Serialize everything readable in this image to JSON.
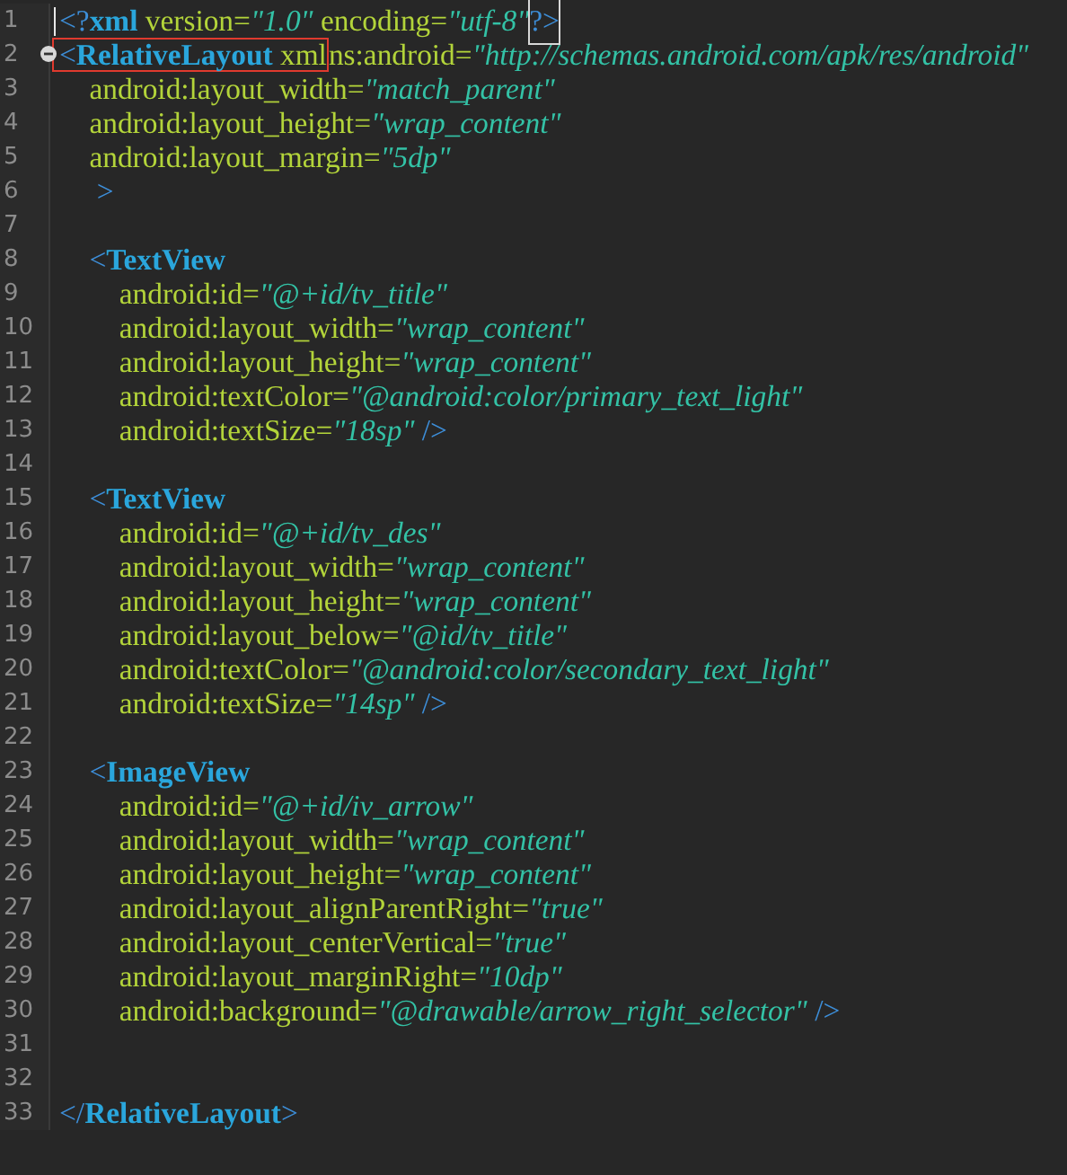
{
  "editor": {
    "lines": [
      {
        "number": "1",
        "caret": true,
        "tokens": [
          {
            "kind": "punct",
            "text": "<?"
          },
          {
            "kind": "tag",
            "text": "xml"
          },
          {
            "kind": "attr",
            "text": " version="
          },
          {
            "kind": "value",
            "text": "\"1.0\""
          },
          {
            "kind": "attr",
            "text": " encoding="
          },
          {
            "kind": "value",
            "text": "\"utf-8\""
          },
          {
            "kind": "punct",
            "text": "?>",
            "matched": true
          }
        ]
      },
      {
        "number": "2",
        "fold": {
          "expanded": true
        },
        "tokens": [
          {
            "kind": "punct",
            "text": "<",
            "boxed": true
          },
          {
            "kind": "tag",
            "text": "RelativeLayout",
            "boxed": true
          },
          {
            "kind": "attr",
            "text": " xml",
            "boxed": true
          },
          {
            "kind": "attr",
            "text": "ns:android="
          },
          {
            "kind": "value",
            "text": "\"http://schemas.android.com/apk/res/android\""
          }
        ]
      },
      {
        "number": "3",
        "tokens": [
          {
            "kind": "attr",
            "text": "    android:layout_width="
          },
          {
            "kind": "value",
            "text": "\"match_parent\""
          }
        ]
      },
      {
        "number": "4",
        "tokens": [
          {
            "kind": "attr",
            "text": "    android:layout_height="
          },
          {
            "kind": "value",
            "text": "\"wrap_content\""
          }
        ]
      },
      {
        "number": "5",
        "tokens": [
          {
            "kind": "attr",
            "text": "    android:layout_margin="
          },
          {
            "kind": "value",
            "text": "\"5dp\""
          }
        ]
      },
      {
        "number": "6",
        "tokens": [
          {
            "kind": "punct",
            "text": "     >"
          }
        ]
      },
      {
        "number": "7"
      },
      {
        "number": "8",
        "tokens": [
          {
            "kind": "punct",
            "text": "    <"
          },
          {
            "kind": "tag",
            "text": "TextView"
          }
        ]
      },
      {
        "number": "9",
        "tokens": [
          {
            "kind": "attr",
            "text": "        android:id="
          },
          {
            "kind": "value",
            "text": "\"@+id/tv_title\""
          }
        ]
      },
      {
        "number": "10",
        "tokens": [
          {
            "kind": "attr",
            "text": "        android:layout_width="
          },
          {
            "kind": "value",
            "text": "\"wrap_content\""
          }
        ]
      },
      {
        "number": "11",
        "tokens": [
          {
            "kind": "attr",
            "text": "        android:layout_height="
          },
          {
            "kind": "value",
            "text": "\"wrap_content\""
          }
        ]
      },
      {
        "number": "12",
        "tokens": [
          {
            "kind": "attr",
            "text": "        android:textColor="
          },
          {
            "kind": "value",
            "text": "\"@android:color/primary_text_light\""
          }
        ]
      },
      {
        "number": "13",
        "tokens": [
          {
            "kind": "attr",
            "text": "        android:textSize="
          },
          {
            "kind": "value",
            "text": "\"18sp\""
          },
          {
            "kind": "punct",
            "text": " />"
          }
        ]
      },
      {
        "number": "14"
      },
      {
        "number": "15",
        "tokens": [
          {
            "kind": "punct",
            "text": "    <"
          },
          {
            "kind": "tag",
            "text": "TextView"
          }
        ]
      },
      {
        "number": "16",
        "tokens": [
          {
            "kind": "attr",
            "text": "        android:id="
          },
          {
            "kind": "value",
            "text": "\"@+id/tv_des\""
          }
        ]
      },
      {
        "number": "17",
        "tokens": [
          {
            "kind": "attr",
            "text": "        android:layout_width="
          },
          {
            "kind": "value",
            "text": "\"wrap_content\""
          }
        ]
      },
      {
        "number": "18",
        "tokens": [
          {
            "kind": "attr",
            "text": "        android:layout_height="
          },
          {
            "kind": "value",
            "text": "\"wrap_content\""
          }
        ]
      },
      {
        "number": "19",
        "tokens": [
          {
            "kind": "attr",
            "text": "        android:layout_below="
          },
          {
            "kind": "value",
            "text": "\"@id/tv_title\""
          }
        ]
      },
      {
        "number": "20",
        "tokens": [
          {
            "kind": "attr",
            "text": "        android:textColor="
          },
          {
            "kind": "value",
            "text": "\"@android:color/secondary_text_light\""
          }
        ]
      },
      {
        "number": "21",
        "tokens": [
          {
            "kind": "attr",
            "text": "        android:textSize="
          },
          {
            "kind": "value",
            "text": "\"14sp\""
          },
          {
            "kind": "punct",
            "text": " />"
          }
        ]
      },
      {
        "number": "22"
      },
      {
        "number": "23",
        "tokens": [
          {
            "kind": "punct",
            "text": "    <"
          },
          {
            "kind": "tag",
            "text": "ImageView"
          }
        ]
      },
      {
        "number": "24",
        "tokens": [
          {
            "kind": "attr",
            "text": "        android:id="
          },
          {
            "kind": "value",
            "text": "\"@+id/iv_arrow\""
          }
        ]
      },
      {
        "number": "25",
        "tokens": [
          {
            "kind": "attr",
            "text": "        android:layout_width="
          },
          {
            "kind": "value",
            "text": "\"wrap_content\""
          }
        ]
      },
      {
        "number": "26",
        "tokens": [
          {
            "kind": "attr",
            "text": "        android:layout_height="
          },
          {
            "kind": "value",
            "text": "\"wrap_content\""
          }
        ]
      },
      {
        "number": "27",
        "tokens": [
          {
            "kind": "attr",
            "text": "        android:layout_alignParentRight="
          },
          {
            "kind": "value",
            "text": "\"true\""
          }
        ]
      },
      {
        "number": "28",
        "tokens": [
          {
            "kind": "attr",
            "text": "        android:layout_centerVertical="
          },
          {
            "kind": "value",
            "text": "\"true\""
          }
        ]
      },
      {
        "number": "29",
        "tokens": [
          {
            "kind": "attr",
            "text": "        android:layout_marginRight="
          },
          {
            "kind": "value",
            "text": "\"10dp\""
          }
        ]
      },
      {
        "number": "30",
        "tokens": [
          {
            "kind": "attr",
            "text": "        android:background="
          },
          {
            "kind": "value",
            "text": "\"@drawable/arrow_right_selector\""
          },
          {
            "kind": "punct",
            "text": " />"
          }
        ]
      },
      {
        "number": "31"
      },
      {
        "number": "32"
      },
      {
        "number": "33",
        "tokens": [
          {
            "kind": "punct",
            "text": "</"
          },
          {
            "kind": "tag",
            "text": "RelativeLayout"
          },
          {
            "kind": "punct",
            "text": ">"
          }
        ]
      }
    ]
  }
}
